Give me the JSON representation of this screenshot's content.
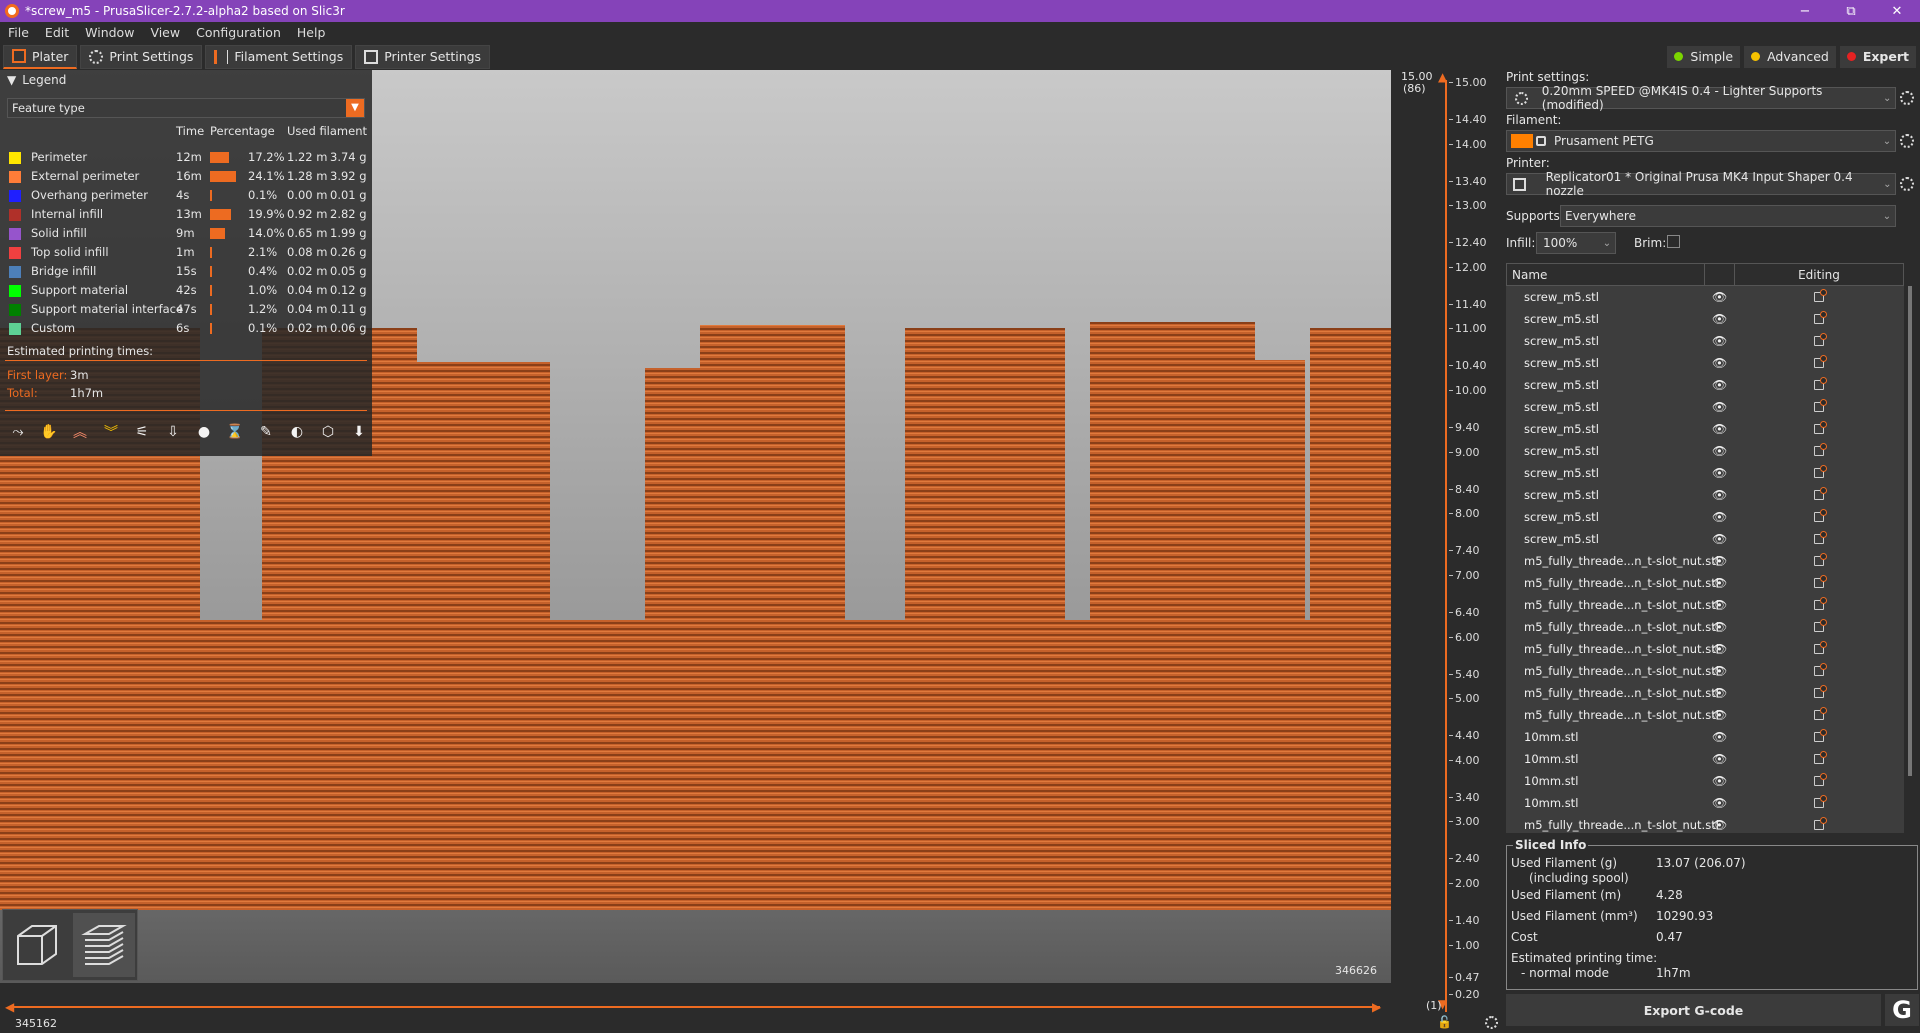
{
  "window": {
    "title": "*screw_m5 - PrusaSlicer-2.7.2-alpha2 based on Slic3r",
    "controls": [
      "−",
      "⧉",
      "✕"
    ]
  },
  "menu": [
    "File",
    "Edit",
    "Window",
    "View",
    "Configuration",
    "Help"
  ],
  "tabs": [
    {
      "label": "Plater",
      "icon": "plater-icon"
    },
    {
      "label": "Print Settings",
      "icon": "print-settings-icon"
    },
    {
      "label": "Filament Settings",
      "icon": "filament-icon"
    },
    {
      "label": "Printer Settings",
      "icon": "printer-icon"
    }
  ],
  "modes": [
    {
      "label": "Simple",
      "color": "#7bd500"
    },
    {
      "label": "Advanced",
      "color": "#f7c200"
    },
    {
      "label": "Expert",
      "color": "#e52222"
    }
  ],
  "legend": {
    "title": "Legend",
    "view_type": "Feature type",
    "columns": {
      "time": "Time",
      "percentage": "Percentage",
      "used": "Used filament"
    },
    "rows": [
      {
        "name": "Perimeter",
        "color": "#ffe600",
        "time": "12m",
        "pct": "17.2%",
        "pct_value": 17.2,
        "m": "1.22 m",
        "g": "3.74 g"
      },
      {
        "name": "External perimeter",
        "color": "#ff7d38",
        "time": "16m",
        "pct": "24.1%",
        "pct_value": 24.1,
        "m": "1.28 m",
        "g": "3.92 g"
      },
      {
        "name": "Overhang perimeter",
        "color": "#1f1fff",
        "time": "4s",
        "pct": "0.1%",
        "pct_value": 0.1,
        "m": "0.00 m",
        "g": "0.01 g"
      },
      {
        "name": "Internal infill",
        "color": "#b03029",
        "time": "13m",
        "pct": "19.9%",
        "pct_value": 19.9,
        "m": "0.92 m",
        "g": "2.82 g"
      },
      {
        "name": "Solid infill",
        "color": "#9654cc",
        "time": "9m",
        "pct": "14.0%",
        "pct_value": 14.0,
        "m": "0.65 m",
        "g": "1.99 g"
      },
      {
        "name": "Top solid infill",
        "color": "#f04040",
        "time": "1m",
        "pct": "2.1%",
        "pct_value": 2.1,
        "m": "0.08 m",
        "g": "0.26 g"
      },
      {
        "name": "Bridge infill",
        "color": "#4d80ba",
        "time": "15s",
        "pct": "0.4%",
        "pct_value": 0.4,
        "m": "0.02 m",
        "g": "0.05 g"
      },
      {
        "name": "Support material",
        "color": "#00ff00",
        "time": "42s",
        "pct": "1.0%",
        "pct_value": 1.0,
        "m": "0.04 m",
        "g": "0.12 g"
      },
      {
        "name": "Support material interface",
        "color": "#008000",
        "time": "47s",
        "pct": "1.2%",
        "pct_value": 1.2,
        "m": "0.04 m",
        "g": "0.11 g"
      },
      {
        "name": "Custom",
        "color": "#5ed194",
        "time": "6s",
        "pct": "0.1%",
        "pct_value": 0.1,
        "m": "0.02 m",
        "g": "0.06 g"
      }
    ],
    "est_label": "Estimated printing times:",
    "first_layer_label": "First layer:",
    "first_layer": "3m",
    "total_label": "Total:",
    "total": "1h7m"
  },
  "hslider": {
    "left_value": "345162",
    "right_value": "346626"
  },
  "vslider": {
    "top_value": "15.00",
    "top_layer": "(86)",
    "bottom_layer": "(1)",
    "ticks": [
      "15.00",
      "14.40",
      "14.00",
      "13.40",
      "13.00",
      "12.40",
      "12.00",
      "11.40",
      "11.00",
      "10.40",
      "10.00",
      "9.40",
      "9.00",
      "8.40",
      "8.00",
      "7.40",
      "7.00",
      "6.40",
      "6.00",
      "5.40",
      "5.00",
      "4.40",
      "4.00",
      "3.40",
      "3.00",
      "2.40",
      "2.00",
      "1.40",
      "1.00",
      "0.47",
      "0.20"
    ]
  },
  "sidebar": {
    "print_label": "Print settings:",
    "print_value": "0.20mm SPEED @MK4IS 0.4 - Lighter Supports (modified)",
    "filament_label": "Filament:",
    "filament_value": "Prusament PETG",
    "filament_color": "#ff8000",
    "printer_label": "Printer:",
    "printer_value": "Replicator01 * Original Prusa MK4 Input Shaper 0.4 nozzle",
    "supports_label": "Supports:",
    "supports_value": "Everywhere",
    "infill_label": "Infill:",
    "infill_value": "100%",
    "brim_label": "Brim:",
    "col_name": "Name",
    "col_editing": "Editing",
    "objects": [
      "screw_m5.stl",
      "screw_m5.stl",
      "screw_m5.stl",
      "screw_m5.stl",
      "screw_m5.stl",
      "screw_m5.stl",
      "screw_m5.stl",
      "screw_m5.stl",
      "screw_m5.stl",
      "screw_m5.stl",
      "screw_m5.stl",
      "screw_m5.stl",
      "m5_fully_threade...n_t-slot_nut.stl",
      "m5_fully_threade...n_t-slot_nut.stl",
      "m5_fully_threade...n_t-slot_nut.stl",
      "m5_fully_threade...n_t-slot_nut.stl",
      "m5_fully_threade...n_t-slot_nut.stl",
      "m5_fully_threade...n_t-slot_nut.stl",
      "m5_fully_threade...n_t-slot_nut.stl",
      "m5_fully_threade...n_t-slot_nut.stl",
      "10mm.stl",
      "10mm.stl",
      "10mm.stl",
      "10mm.stl",
      "m5_fully_threade...n_t-slot_nut.stl"
    ],
    "sliced_title": "Sliced Info",
    "sliced": [
      {
        "k": "Used Filament (g)",
        "k2": "(including spool)",
        "v": "13.07 (206.07)"
      },
      {
        "k": "Used Filament (m)",
        "v": "4.28"
      },
      {
        "k": "Used Filament (mm³)",
        "v": "10290.93"
      },
      {
        "k": "Cost",
        "v": "0.47"
      },
      {
        "k": "Estimated printing time:",
        "k2": "- normal mode",
        "v": "1h7m"
      }
    ],
    "export_label": "Export G-code"
  }
}
